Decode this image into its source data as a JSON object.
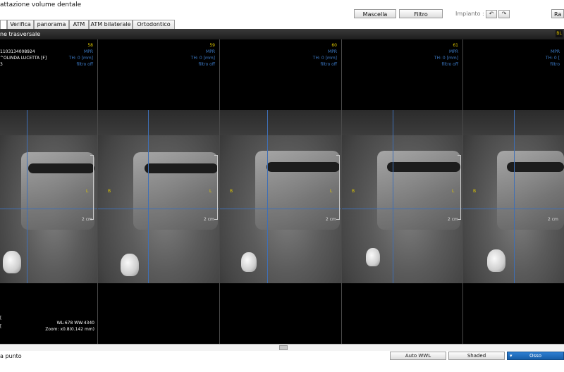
{
  "title": "attazione volume dentale",
  "header_buttons": {
    "mascella": "Mascella",
    "filtro": "Filtro",
    "impianto": "Impianto :",
    "right_partial": "Ra"
  },
  "tabs": [
    {
      "label": "",
      "active": true
    },
    {
      "label": "Verifica"
    },
    {
      "label": "panorama"
    },
    {
      "label": "ATM"
    },
    {
      "label": "ATM bilaterale"
    },
    {
      "label": "Ortodontico"
    }
  ],
  "section": {
    "title": "ne trasversale",
    "badge": "BL"
  },
  "patient": {
    "id": "1103134008924",
    "name": "^OLINDA LUCETTA [F]",
    "extra": "3"
  },
  "panels": [
    {
      "number": "58",
      "mode": "MPR",
      "th": "TH: 0 [mm]",
      "filter": "filtro off",
      "right_mark": "L",
      "left_mark": "",
      "scale": "2 cm"
    },
    {
      "number": "59",
      "mode": "MPR",
      "th": "TH: 0 [mm]",
      "filter": "filtro off",
      "right_mark": "L",
      "left_mark": "B",
      "scale": "2 cm"
    },
    {
      "number": "60",
      "mode": "MPR",
      "th": "TH: 0 [mm]",
      "filter": "filtro off",
      "right_mark": "L",
      "left_mark": "B",
      "scale": "2 cm"
    },
    {
      "number": "61",
      "mode": "MPR",
      "th": "TH: 0 [mm]",
      "filter": "filtro off",
      "right_mark": "L",
      "left_mark": "B",
      "scale": "2 cm"
    },
    {
      "number": "",
      "mode": "MPR",
      "th": "TH: 0 [",
      "filter": "filtro",
      "right_mark": "",
      "left_mark": "B",
      "scale": "2 cm"
    }
  ],
  "overlay": {
    "wl": "WL:678 WW:4340",
    "zoom": "Zoom: x0.8(0.142 mm)"
  },
  "status": {
    "left": "a punto"
  },
  "bottom_buttons": {
    "auto_wwl": "Auto WWL",
    "shaded": "Shaded",
    "osso": "Osso"
  },
  "colors": {
    "crosshair": "#3f6fb5",
    "slice_number": "#e0c900",
    "info_text": "#3d7cc9",
    "accent_button": "#1f6fbf"
  }
}
